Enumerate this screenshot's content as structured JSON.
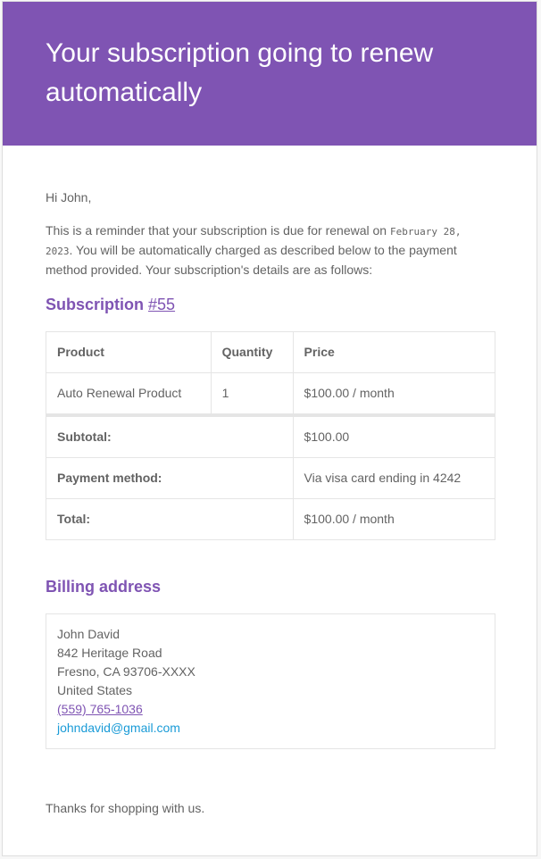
{
  "header": {
    "title": "Your subscription going to renew automatically"
  },
  "body": {
    "greeting": "Hi John,",
    "intro_before_date": "This is a reminder that your subscription is due for renewal on ",
    "renewal_date": "February 28, 2023",
    "intro_after_date": ". You will be automatically charged as described below to the payment method provided. Your subscription's details are as follows:"
  },
  "subscription": {
    "heading_label": "Subscription ",
    "number_link": "#55"
  },
  "table": {
    "columns": [
      "Product",
      "Quantity",
      "Price"
    ],
    "rows": [
      {
        "product": "Auto Renewal Product",
        "quantity": "1",
        "price": "$100.00 / month"
      }
    ],
    "totals": [
      {
        "label": "Subtotal:",
        "value": "$100.00"
      },
      {
        "label": "Payment method:",
        "value": "Via visa card ending in 4242"
      },
      {
        "label": "Total:",
        "value": "$100.00 / month"
      }
    ]
  },
  "billing": {
    "heading": "Billing address",
    "name": "John David",
    "street": "842 Heritage Road",
    "city_line": "Fresno, CA 93706-XXXX",
    "country": "United States",
    "phone": "(559) 765-1036",
    "email": "johndavid@gmail.com"
  },
  "footer": {
    "closing": "Thanks for shopping with us."
  },
  "colors": {
    "accent": "#7f54b3",
    "link_blue": "#1a9bd7",
    "text": "#636363"
  }
}
